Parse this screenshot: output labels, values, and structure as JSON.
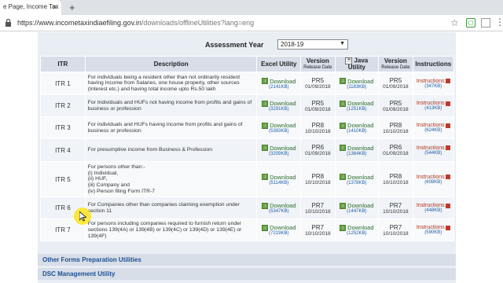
{
  "browser": {
    "tab_title": "e Page, Income Tax",
    "url_host": "https://www.incometaxindiaefiling.gov.in",
    "url_path": "/downloads/offlineUtilities?lang=eng"
  },
  "assessment": {
    "label": "Assessment Year",
    "selected": "2018-19"
  },
  "table": {
    "headers": {
      "itr": "ITR",
      "description": "Description",
      "excel": "Excel Utility",
      "version": "Version",
      "release_date": "Release Date",
      "java": "Java Utility",
      "version2": "Version",
      "release_date2": "Release Date",
      "instructions": "Instructions"
    },
    "download_label": "Download",
    "instructions_label": "Instructions",
    "rows": [
      {
        "itr": "ITR 1",
        "desc": "For individuals being a resident other than not ordinarily resident having Income from Salaries, one house property, other sources (Interest etc.) and having total income upto Rs.50 lakh",
        "excel_size": "(2141KB)",
        "excel_ver": "PR5",
        "excel_date": "01/09/2018",
        "java_size": "(1183KB)",
        "java_ver": "PR5",
        "java_date": "01/09/2018",
        "inst_size": "(347KB)"
      },
      {
        "itr": "ITR 2",
        "desc": "For Individuals and HUFs not having income from profits and gains of business or profession",
        "excel_size": "(3291KB)",
        "excel_ver": "PR5",
        "excel_date": "01/09/2018",
        "java_size": "(1251KB)",
        "java_ver": "PR5",
        "java_date": "01/09/2018",
        "inst_size": "(413KB)"
      },
      {
        "itr": "ITR 3",
        "desc": "For individuals and HUFs having income from profits and gains of business or profession",
        "excel_size": "(5393KB)",
        "excel_ver": "PR8",
        "excel_date": "10/10/2018",
        "java_size": "(1410KB)",
        "java_ver": "PR8",
        "java_date": "10/10/2018",
        "inst_size": "(624KB)"
      },
      {
        "itr": "ITR 4",
        "desc": "For presumptive income from Business & Profession",
        "excel_size": "(3209KB)",
        "excel_ver": "PR6",
        "excel_date": "01/09/2018",
        "java_size": "(1364KB)",
        "java_ver": "PR6",
        "java_date": "01/09/2018",
        "inst_size": "(544KB)"
      },
      {
        "itr": "ITR 5",
        "desc": "For persons other than:-\n(i) Individual,\n(ii) HUF,\n(iii) Company and\n(iv) Person filing Form ITR-7",
        "excel_size": "(5114KB)",
        "excel_ver": "PR8",
        "excel_date": "10/10/2018",
        "java_size": "(1378KB)",
        "java_ver": "PR8",
        "java_date": "10/10/2018",
        "inst_size": "(608KB)"
      },
      {
        "itr": "ITR 6",
        "desc": "For Companies other than companies claiming exemption under section 11",
        "excel_size": "(5347KB)",
        "excel_ver": "PR7",
        "excel_date": "10/10/2018",
        "java_size": "(1447KB)",
        "java_ver": "PR7",
        "java_date": "10/10/2018",
        "inst_size": "(448KB)"
      },
      {
        "itr": "ITR 7",
        "desc": "For persons including companies required to furnish return under sections 139(4A) or 139(4B) or 139(4C) or 139(4D) or 139(4E) or 139(4F)",
        "excel_size": "(7219KB)",
        "excel_ver": "PR7",
        "excel_date": "10/10/2018",
        "java_size": "(1252KB)",
        "java_ver": "PR7",
        "java_date": "10/10/2018",
        "inst_size": "(590KB)"
      }
    ]
  },
  "sections": {
    "other_forms": "Other Forms Preparation Utilities",
    "dsc": "DSC Management Utility"
  }
}
